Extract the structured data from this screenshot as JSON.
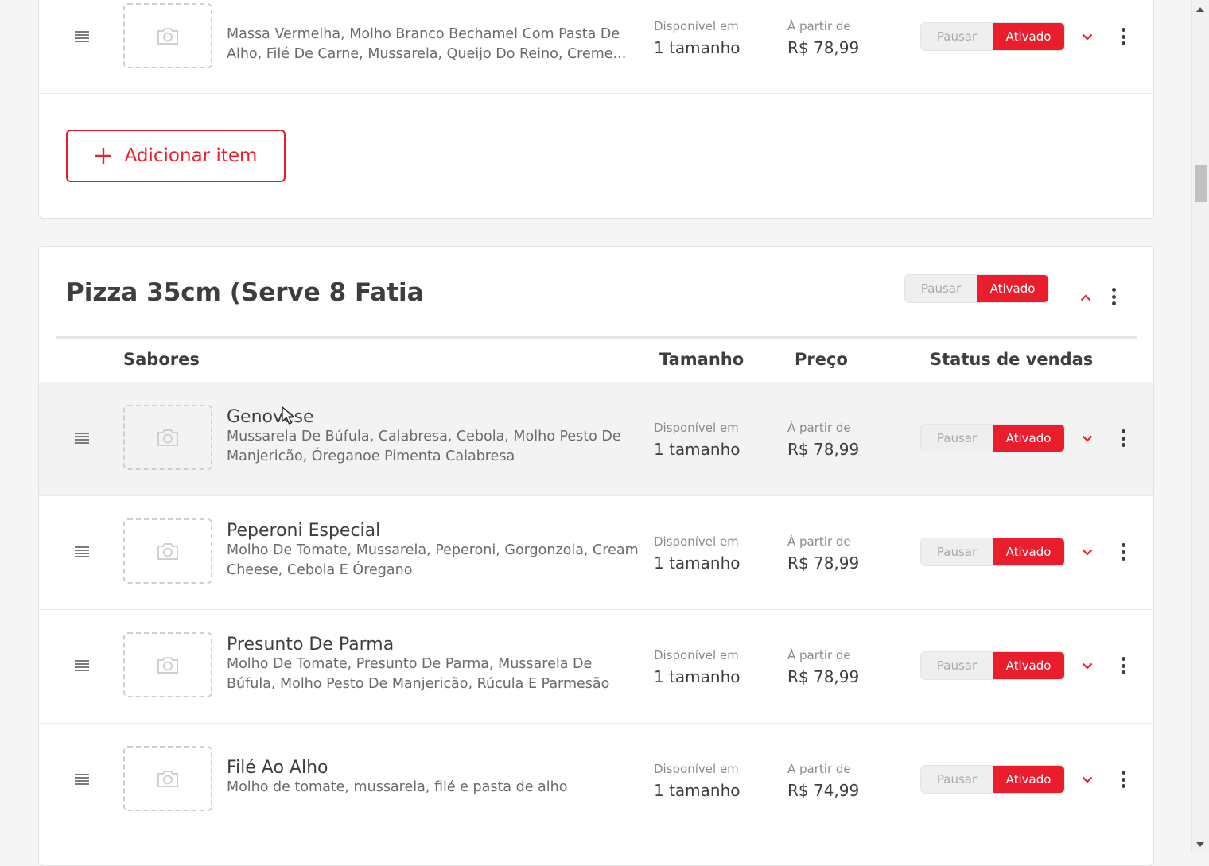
{
  "colors": {
    "accent": "#ea1d2c",
    "text": "#3f3e3e",
    "muted": "#6a6a6a"
  },
  "top_item": {
    "description": "Massa Vermelha, Molho Branco Bechamel Com Pasta De Alho, Filé De Carne, Mussarela, Queijo Do Reino, Creme...",
    "availability_label": "Disponível em",
    "availability_value": "1 tamanho",
    "price_label": "À partir de",
    "price_value": "R$ 78,99",
    "pause_label": "Pausar",
    "active_label": "Ativado"
  },
  "add_item_label": "Adicionar item",
  "category": {
    "title": "Pizza 35cm (Serve 8 Fatia",
    "pause_label": "Pausar",
    "active_label": "Ativado",
    "columns": {
      "flavors": "Sabores",
      "size": "Tamanho",
      "price": "Preço",
      "status": "Status de vendas"
    },
    "items": [
      {
        "name": "Genovese",
        "description": "Mussarela De Búfula, Calabresa, Cebola, Molho Pesto De Manjericão, Óreganoe Pimenta Calabresa",
        "availability_label": "Disponível em",
        "availability_value": "1 tamanho",
        "price_label": "À partir de",
        "price_value": "R$ 78,99",
        "pause_label": "Pausar",
        "active_label": "Ativado"
      },
      {
        "name": "Peperoni Especial",
        "description": "Molho De Tomate, Mussarela, Peperoni, Gorgonzola, Cream Cheese, Cebola E Óregano",
        "availability_label": "Disponível em",
        "availability_value": "1 tamanho",
        "price_label": "À partir de",
        "price_value": "R$ 78,99",
        "pause_label": "Pausar",
        "active_label": "Ativado"
      },
      {
        "name": "Presunto De Parma",
        "description": "Molho De Tomate, Presunto De Parma, Mussarela De Búfula, Molho Pesto De Manjericão, Rúcula E Parmesão",
        "availability_label": "Disponível em",
        "availability_value": "1 tamanho",
        "price_label": "À partir de",
        "price_value": "R$ 78,99",
        "pause_label": "Pausar",
        "active_label": "Ativado"
      },
      {
        "name": "Filé Ao Alho",
        "description": "Molho de tomate, mussarela, filé e pasta de alho",
        "availability_label": "Disponível em",
        "availability_value": "1 tamanho",
        "price_label": "À partir de",
        "price_value": "R$ 74,99",
        "pause_label": "Pausar",
        "active_label": "Ativado"
      }
    ]
  }
}
